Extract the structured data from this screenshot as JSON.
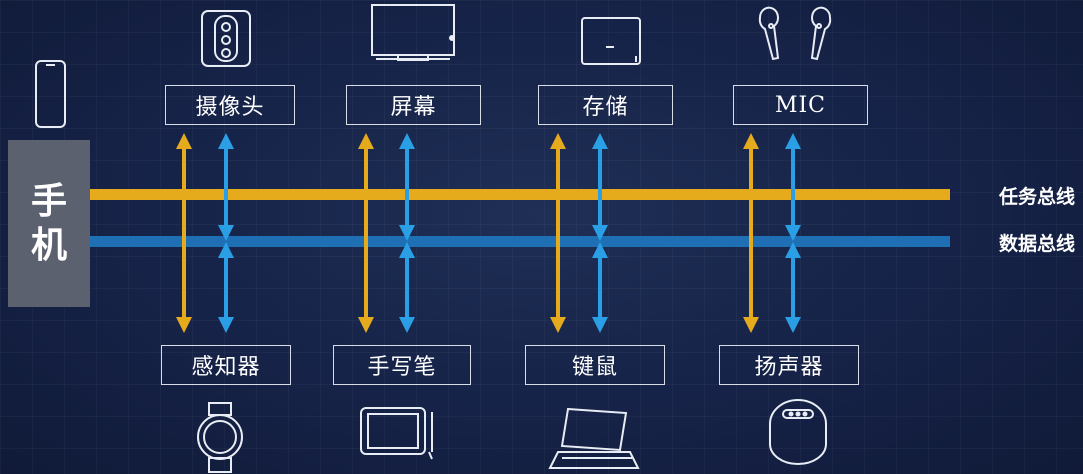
{
  "phone": {
    "char1": "手",
    "char2": "机"
  },
  "buses": {
    "task": "任务总线",
    "data": "数据总线"
  },
  "top_devices": [
    "摄像头",
    "屏幕",
    "存储",
    "MIC"
  ],
  "bottom_devices": [
    "感知器",
    "手写笔",
    "键鼠",
    "扬声器"
  ],
  "colors": {
    "task_bus": "#e5ab1c",
    "data_bus": "#1e6fb4",
    "data_arrow": "#2a9fe6",
    "background": "#17244a"
  }
}
